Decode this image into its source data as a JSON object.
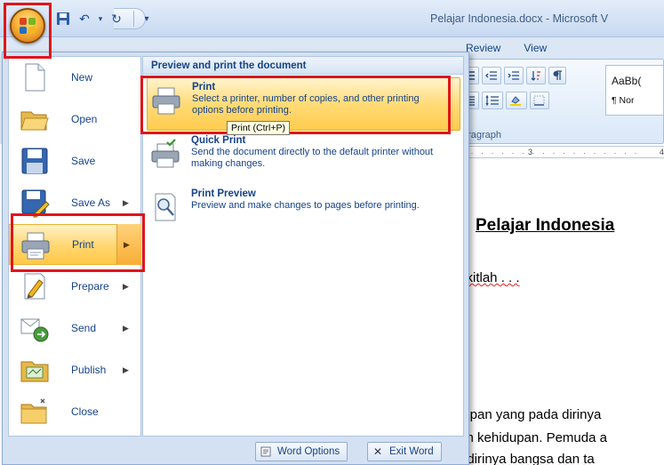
{
  "window": {
    "title": "Pelajar Indonesia.docx - Microsoft V"
  },
  "office_button": {
    "label": "Office Button",
    "colors": {
      "glow": "#f7b43a",
      "rim": "#8a4b07"
    }
  },
  "ribbon": {
    "tabs": [
      "Review",
      "View"
    ],
    "group_label": "aragraph",
    "styles": {
      "sample": "AaBb(",
      "normal": "¶ Nor"
    }
  },
  "ruler": {
    "marks": [
      "3",
      "4"
    ]
  },
  "office_menu": {
    "commands": [
      {
        "label": "New",
        "has_submenu": false,
        "active": false
      },
      {
        "label": "Open",
        "has_submenu": false,
        "active": false
      },
      {
        "label": "Save",
        "has_submenu": false,
        "active": false
      },
      {
        "label": "Save As",
        "has_submenu": true,
        "active": false
      },
      {
        "label": "Print",
        "has_submenu": true,
        "active": true
      },
      {
        "label": "Prepare",
        "has_submenu": true,
        "active": false
      },
      {
        "label": "Send",
        "has_submenu": true,
        "active": false
      },
      {
        "label": "Publish",
        "has_submenu": true,
        "active": false
      },
      {
        "label": "Close",
        "has_submenu": false,
        "active": false
      }
    ],
    "panel": {
      "header": "Preview and print the document",
      "items": [
        {
          "title": "Print",
          "description": "Select a printer, number of copies, and other printing options before printing."
        },
        {
          "title": "Quick Print",
          "description": "Send the document directly to the default printer without making changes."
        },
        {
          "title": "Print Preview",
          "description": "Preview and make changes to pages before printing."
        }
      ]
    },
    "tooltip": "Print (Ctrl+P)",
    "footer": {
      "options_label": "Word Options",
      "exit_label": "Exit Word"
    }
  },
  "document": {
    "title": "Pelajar Indonesia",
    "lines": [
      "ıgkitlah . . .",
      "dupan yang pada dirinya",
      "am kehidupan. Pemuda a",
      "erdirinya bangsa dan ta"
    ]
  },
  "highlight_color": "#e0151a"
}
